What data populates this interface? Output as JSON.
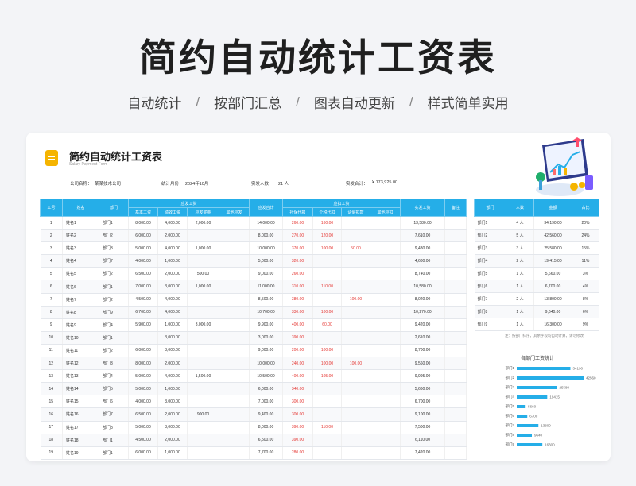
{
  "hero": {
    "title": "简约自动统计工资表"
  },
  "subnav": {
    "items": [
      "自动统计",
      "按部门汇总",
      "图表自动更新",
      "样式简单实用"
    ],
    "sep": "/"
  },
  "sheet": {
    "title": "简约自动统计工资表",
    "subtitle": "Salary Payment Form",
    "info": {
      "company_label": "公司名称：",
      "company": "某某技术公司",
      "month_label": "统计月份：",
      "month": "2024年10月",
      "people_label": "实发人数：",
      "people": "21 人",
      "total_label": "实发合计：",
      "total": "¥ 173,925.00"
    },
    "headers": {
      "id": "工号",
      "name": "姓名",
      "dept": "部门",
      "should_group": "应发工资",
      "base": "基本工资",
      "perf": "绩效工资",
      "bonus": "应发奖金",
      "other_add": "其他应发",
      "should_total": "应发合计",
      "deduct_group": "应扣工资",
      "social": "社保代扣",
      "tax": "个税代扣",
      "leave": "请假扣款",
      "other_sub": "其他应扣",
      "net": "实发工资",
      "remark": "备注"
    },
    "rows": [
      [
        "1",
        "姓名1",
        "部门1",
        "8,000.00",
        "4,000.00",
        "2,000.00",
        "",
        "14,000.00",
        "260.00",
        "160.00",
        "",
        "",
        "13,580.00",
        ""
      ],
      [
        "2",
        "姓名2",
        "部门2",
        "6,000.00",
        "2,000.00",
        "",
        "",
        "8,000.00",
        "270.00",
        "120.00",
        "",
        "",
        "7,610.00",
        ""
      ],
      [
        "3",
        "姓名3",
        "部门3",
        "5,000.00",
        "4,000.00",
        "1,000.00",
        "",
        "10,000.00",
        "370.00",
        "100.00",
        "50.00",
        "",
        "9,480.00",
        ""
      ],
      [
        "4",
        "姓名4",
        "部门7",
        "4,000.00",
        "1,000.00",
        "",
        "",
        "5,000.00",
        "320.00",
        "",
        "",
        "",
        "4,680.00",
        ""
      ],
      [
        "5",
        "姓名5",
        "部门2",
        "6,500.00",
        "2,000.00",
        "500.00",
        "",
        "9,000.00",
        "260.00",
        "",
        "",
        "",
        "8,740.00",
        ""
      ],
      [
        "6",
        "姓名6",
        "部门1",
        "7,000.00",
        "3,000.00",
        "1,000.00",
        "",
        "11,000.00",
        "310.00",
        "110.00",
        "",
        "",
        "10,580.00",
        ""
      ],
      [
        "7",
        "姓名7",
        "部门2",
        "4,500.00",
        "4,000.00",
        "",
        "",
        "8,500.00",
        "380.00",
        "",
        "100.00",
        "",
        "8,020.00",
        ""
      ],
      [
        "8",
        "姓名8",
        "部门9",
        "6,700.00",
        "4,000.00",
        "",
        "",
        "10,700.00",
        "330.00",
        "100.00",
        "",
        "",
        "10,270.00",
        ""
      ],
      [
        "9",
        "姓名9",
        "部门4",
        "5,900.00",
        "1,000.00",
        "3,000.00",
        "",
        "9,900.00",
        "400.00",
        "60.00",
        "",
        "",
        "9,420.00",
        ""
      ],
      [
        "10",
        "姓名10",
        "部门1",
        "",
        "3,000.00",
        "",
        "",
        "3,000.00",
        "390.00",
        "",
        "",
        "",
        "2,610.00",
        ""
      ],
      [
        "11",
        "姓名11",
        "部门2",
        "6,000.00",
        "3,000.00",
        "",
        "",
        "9,000.00",
        "200.00",
        "100.00",
        "",
        "",
        "8,700.00",
        ""
      ],
      [
        "12",
        "姓名12",
        "部门3",
        "8,000.00",
        "2,000.00",
        "",
        "",
        "10,000.00",
        "240.00",
        "100.00",
        "100.00",
        "",
        "9,560.00",
        ""
      ],
      [
        "13",
        "姓名13",
        "部门4",
        "5,000.00",
        "4,000.00",
        "1,500.00",
        "",
        "10,500.00",
        "400.00",
        "105.00",
        "",
        "",
        "9,995.00",
        ""
      ],
      [
        "14",
        "姓名14",
        "部门5",
        "5,000.00",
        "1,000.00",
        "",
        "",
        "6,000.00",
        "340.00",
        "",
        "",
        "",
        "5,660.00",
        ""
      ],
      [
        "15",
        "姓名15",
        "部门6",
        "4,000.00",
        "3,000.00",
        "",
        "",
        "7,000.00",
        "300.00",
        "",
        "",
        "",
        "6,700.00",
        ""
      ],
      [
        "16",
        "姓名16",
        "部门7",
        "6,500.00",
        "2,000.00",
        "900.00",
        "",
        "9,400.00",
        "300.00",
        "",
        "",
        "",
        "9,100.00",
        ""
      ],
      [
        "17",
        "姓名17",
        "部门8",
        "5,000.00",
        "3,000.00",
        "",
        "",
        "8,000.00",
        "390.00",
        "110.00",
        "",
        "",
        "7,500.00",
        ""
      ],
      [
        "18",
        "姓名18",
        "部门1",
        "4,500.00",
        "2,000.00",
        "",
        "",
        "6,500.00",
        "390.00",
        "",
        "",
        "",
        "6,110.00",
        ""
      ],
      [
        "19",
        "姓名19",
        "部门1",
        "6,000.00",
        "1,000.00",
        "",
        "",
        "7,700.00",
        "280.00",
        "",
        "",
        "",
        "7,420.00",
        ""
      ]
    ],
    "summary": {
      "headers": [
        "部门",
        "人数",
        "金额",
        "占比"
      ],
      "rows": [
        [
          "部门1",
          "4 人",
          "34,190.00",
          "20%"
        ],
        [
          "部门2",
          "5 人",
          "42,560.00",
          "24%"
        ],
        [
          "部门3",
          "3 人",
          "25,580.00",
          "15%"
        ],
        [
          "部门4",
          "2 人",
          "19,415.00",
          "11%"
        ],
        [
          "部门5",
          "1 人",
          "5,660.00",
          "3%"
        ],
        [
          "部门6",
          "1 人",
          "6,700.00",
          "4%"
        ],
        [
          "部门7",
          "2 人",
          "13,800.00",
          "8%"
        ],
        [
          "部门8",
          "1 人",
          "9,640.00",
          "6%"
        ],
        [
          "部门9",
          "1 人",
          "16,300.00",
          "9%"
        ]
      ],
      "note": "注：按部门排序，其余字段均自动计算，请勿修改"
    }
  },
  "chart_data": {
    "type": "bar",
    "orientation": "horizontal",
    "title": "各部门工资统计",
    "categories": [
      "部门1",
      "部门2",
      "部门3",
      "部门4",
      "部门5",
      "部门6",
      "部门7",
      "部门8",
      "部门9"
    ],
    "values": [
      34190,
      42560,
      25580,
      19415,
      5660,
      6700,
      13800,
      9640,
      16300
    ],
    "value_labels": [
      "34190",
      "42560",
      "25580",
      "19415",
      "5660",
      "6700",
      "13800",
      "9640",
      "16300"
    ],
    "color": "#25aee8"
  }
}
